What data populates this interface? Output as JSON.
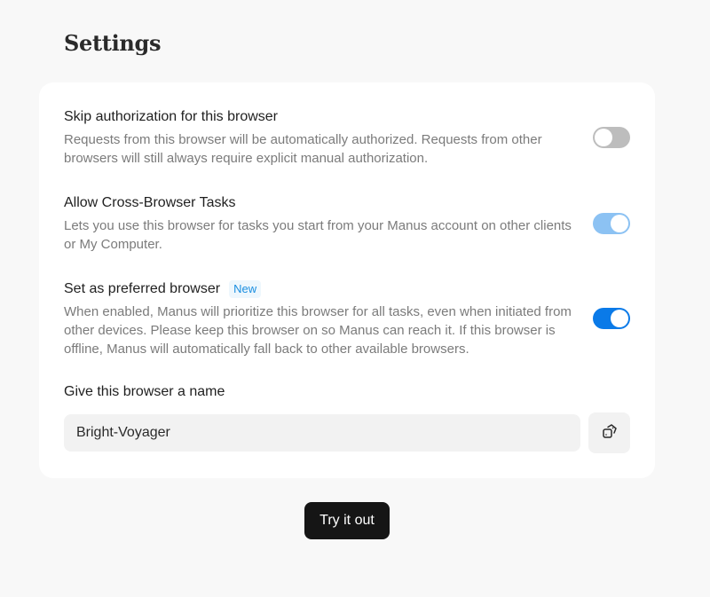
{
  "page": {
    "title": "Settings"
  },
  "settings": [
    {
      "title": "Skip authorization for this browser",
      "description": "Requests from this browser will be automatically authorized. Requests from other browsers will still always require explicit manual authorization.",
      "toggle_state": "off"
    },
    {
      "title": "Allow Cross-Browser Tasks",
      "description": "Lets you use this browser for tasks you start from your Manus account on other clients or My Computer.",
      "toggle_state": "on (disabled)"
    },
    {
      "title": "Set as preferred browser",
      "badge": "New",
      "description": "When enabled, Manus will prioritize this browser for all tasks, even when initiated from other devices. Please keep this browser on so Manus can reach it. If this browser is offline, Manus will automatically fall back to other available browsers.",
      "toggle_state": "on"
    }
  ],
  "browser_name": {
    "label": "Give this browser a name",
    "value": "Bright-Voyager",
    "action_icon": "shuffle-dice-icon"
  },
  "actions": {
    "try_label": "Try it out"
  },
  "colors": {
    "accent": "#0a7ae8",
    "accent_light": "#8cc2f3",
    "toggle_off": "#bdbdbd",
    "badge_text": "#1a8ee0",
    "button_dark": "#151515"
  }
}
